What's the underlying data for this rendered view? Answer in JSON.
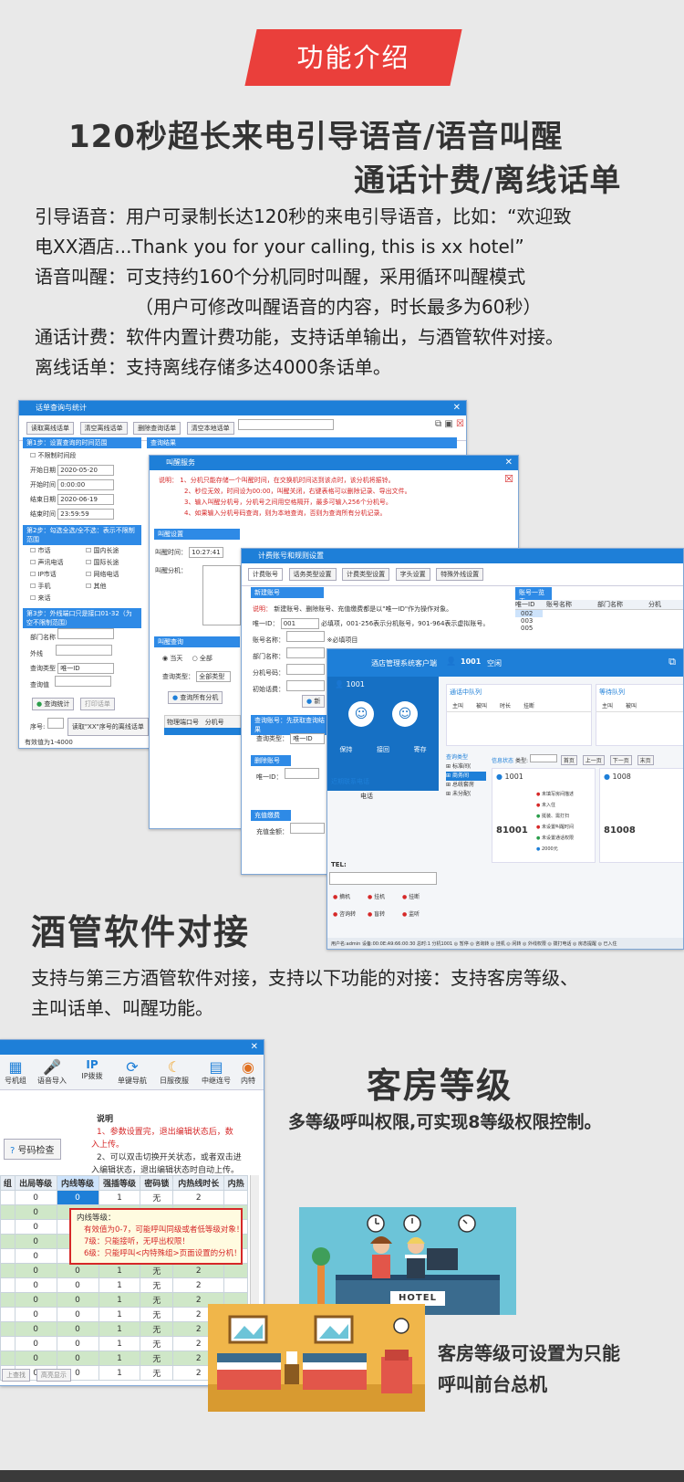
{
  "ribbon": "功能介绍",
  "h1_line1": "120秒超长来电引导语音/语音叫醒",
  "h1_line2": "通话计费/离线话单",
  "paragraphs": {
    "p1": "引导语音：用户可录制长达120秒的来电引导语音，比如：“欢迎致",
    "p2": "电XX酒店...Thank you for your calling, this is xx hotel”",
    "p3": "语音叫醒：可支持约160个分机同时叫醒，采用循环叫醒模式",
    "p4": "（用户可修改叫醒语音的内容，时长最多为60秒）",
    "p5": "通话计费：软件内置计费功能，支持话单输出，与酒管软件对接。",
    "p6": "离线话单：支持离线存储多达4000条话单。"
  },
  "win1": {
    "title": "话单查询与统计",
    "buttons": [
      "读取离线话单",
      "清空离线话单",
      "删除查询话单",
      "清空本地话单"
    ],
    "step1": "第1步：设置查询的时间范围",
    "no_limit": "不限制时间段",
    "start_date_label": "开始日期",
    "start_date": "2020-05-20",
    "start_time_label": "开始时间",
    "start_time": "0:00:00",
    "end_date_label": "结束日期",
    "end_date": "2020-06-19",
    "end_time_label": "结束时间",
    "end_time": "23:59:59",
    "step2": "第2步：勾选全选/全不选：表示不限制范围",
    "types": [
      "市话",
      "国内长途",
      "声讯电话",
      "国际长途",
      "IP市话",
      "网络电话",
      "手机",
      "其他",
      "来话"
    ],
    "step3": "第3步：外线端口只是接口01-32（为空不限制范围）",
    "f_dept": "部门名称",
    "f_trunk": "外线",
    "f_qtype": "查询类型",
    "f_qval": "查询值",
    "qtype_val": "唯一ID",
    "btn_query": "查询统计",
    "btn_print": "打印话单",
    "seq_label": "序号:",
    "read_btn": "读取\"XX\"序号的离线话单",
    "footer": "有效值为1-4000",
    "result": "查询结果"
  },
  "win2": {
    "title": "叫醒服务",
    "note_label": "说明：",
    "notes": [
      "1、分机只能存储一个叫醒时间，在交换机时间达到该点时，该分机将振铃。",
      "2、秒位无效，时间设为00:00，叫醒关闭，右键表格可以删除记录、导出文件。",
      "3、输入叫醒分机号，分机号之间用空格隔开，最多可输入256个分机号。",
      "4、如果输入分机号码查询，则为本地查询，否则为查询所有分机记录。"
    ],
    "set_group": "叫醒设置",
    "time_label": "叫醒时间：",
    "time_val": "10:27:41",
    "ext_label": "叫醒分机：",
    "query_group": "叫醒查询",
    "radio_today": "当天",
    "radio_all": "全部",
    "qtype_label": "查询类型：",
    "qtype_val": "全部类型",
    "query_all_btn": "查询所有分机",
    "col1": "物理端口号",
    "col2": "分机号"
  },
  "win3": {
    "title": "计费账号和规则设置",
    "tabs": [
      "计费账号",
      "话务类型设置",
      "计费类型设置",
      "字头设置",
      "特殊外线设置"
    ],
    "new_group": "新建账号",
    "note": "新建账号、删除账号、充值缴费都是以\"唯一ID\"作为操作对象。",
    "note_label": "说明：",
    "id_label": "唯一ID：",
    "id_val": "001",
    "id_hint": "必填项，001-256表示分机账号，901-964表示虚拟账号。",
    "acc_label": "账号名称：",
    "acc_hint": "※必填项目",
    "dept_label": "部门名称：",
    "ext_label": "分机号码：",
    "init_label": "初始话费：",
    "new_btn": "新",
    "query_group": "查询账号：先获取查询结果",
    "q_label": "查询类型：",
    "q_val": "唯一ID",
    "del_group": "删除账号",
    "del_label": "唯一ID：",
    "charge_group": "充值缴费",
    "charge_label": "充值金额：",
    "list_group": "账号一览表",
    "list_cols": [
      "唯一ID",
      "账号名称",
      "部门名称",
      "分机"
    ],
    "list_rows": [
      "002",
      "003",
      "005"
    ]
  },
  "win4": {
    "title": "酒店管理系统客户端",
    "user": "1001",
    "status": "空闲",
    "op_labels": [
      "保持",
      "接回",
      "寄存"
    ],
    "contact": "近期联系电话",
    "phone": "电话",
    "tel_label": "TEL:",
    "actions": [
      "摘机",
      "挂机",
      "挂断",
      "咨询转",
      "盲转",
      "监听"
    ],
    "queue1": "通话中队列",
    "queue2": "等待队列",
    "cols": [
      "主叫",
      "被叫",
      "时长",
      "挂断",
      "主叫",
      "被叫"
    ],
    "tree_title": "查询类型",
    "tree": [
      "标准间(",
      "商务间",
      "总统套房",
      "未分配("
    ],
    "info_title": "信息状态",
    "type_label": "类型:",
    "nav": [
      "首页",
      "上一页",
      "下一页",
      "末页"
    ],
    "cards": [
      {
        "ext": "1001",
        "room": "81001"
      },
      {
        "ext": "1008",
        "room": "81008"
      }
    ],
    "card_items": [
      "未填写房间描述",
      "未入住",
      "挺装、需打扫",
      "未设置叫醒时间",
      "未设置通话权限",
      "2000元"
    ],
    "statusbar": "用户名:admin 设备:00:0E:A9:66:00:30 总时:1 分机1001 ◎ 暂停 ◎ 咨询转 ◎ 挂机 ◎ 闲转 ◎ 外线权限 ◎ 拨打电话 ◎ 房态提醒 ◎ 已入住"
  },
  "sec2_title": "酒管软件对接",
  "sec2_p1": "支持与第三方酒管软件对接，支持以下功能的对接：支持客房等级、",
  "sec2_p2": "主叫话单、叫醒功能。",
  "win5": {
    "toolbar": [
      "号机组",
      "语音导入",
      "IP拨拨",
      "单键导航",
      "日服夜服",
      "中继连号",
      "内特"
    ],
    "check_btn": "号码检查",
    "desc_title": "说明",
    "desc1": "1、参数设置完，退出编辑状态后，数",
    "desc1b": "入上传。",
    "desc2": "2、可以双击切换开关状态，或者双击进",
    "desc3": "入编辑状态，退出编辑状态时自动上传。",
    "cols": [
      "组",
      "出局等级",
      "内线等级",
      "强插等级",
      "密码锁",
      "内热线时长",
      "内热"
    ],
    "rows": [
      [
        "0",
        "0",
        "1",
        "无",
        "2"
      ],
      [
        "0",
        "0",
        "1",
        "无",
        "2"
      ],
      [
        "0",
        "0",
        "1",
        "无",
        "2"
      ],
      [
        "0",
        "0",
        "1",
        "无",
        "2"
      ],
      [
        "0",
        "0",
        "1",
        "无",
        "2"
      ],
      [
        "0",
        "0",
        "1",
        "无",
        "2"
      ],
      [
        "0",
        "0",
        "1",
        "无",
        "2"
      ],
      [
        "0",
        "0",
        "1",
        "无",
        "2"
      ],
      [
        "0",
        "0",
        "1",
        "无",
        "2"
      ],
      [
        "0",
        "0",
        "1",
        "无",
        "2"
      ],
      [
        "0",
        "0",
        "1",
        "无",
        "2"
      ],
      [
        "0",
        "0",
        "1",
        "无",
        "2"
      ],
      [
        "0",
        "0",
        "1",
        "无",
        "2"
      ]
    ],
    "tip_title": "内线等级：",
    "tip1": "有效值为0-7，可能呼叫同级或者低等级对象！",
    "tip2": "7级：只能接听，无呼出权限！",
    "tip3": "6级：只能呼叫<内特殊组>页面设置的分机！",
    "bottom_btns": [
      "上查找",
      "高亮显示"
    ]
  },
  "sec3_title": "客房等级",
  "sec3_sub": "多等级呼叫权限,可实现8等级权限控制。",
  "hotel_sign": "HOTEL",
  "caption1": "客房等级可设置为只能",
  "caption2": "呼叫前台总机"
}
